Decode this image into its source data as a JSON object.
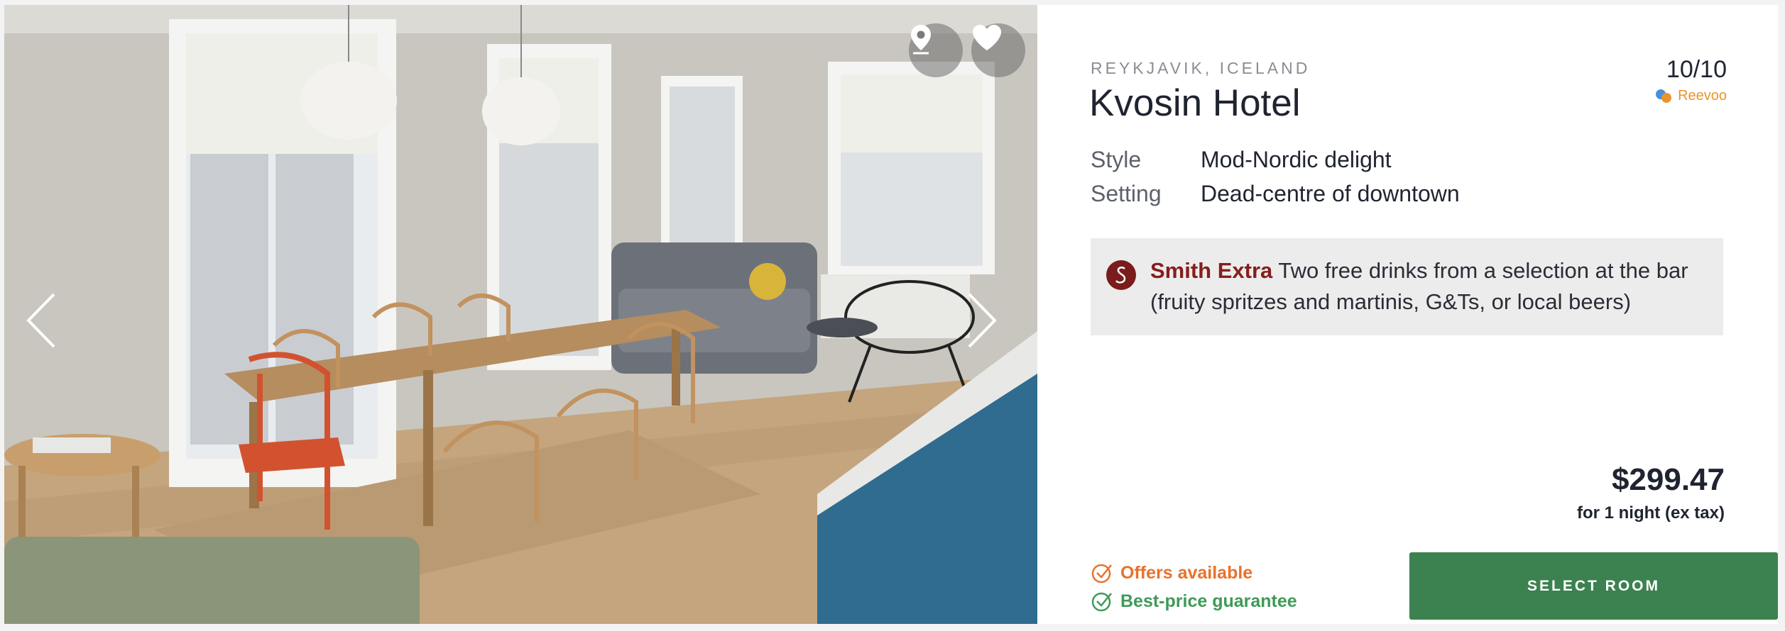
{
  "hotel": {
    "location": "REYKJAVIK, ICELAND",
    "name": "Kvosin Hotel",
    "score": "10/10",
    "review_source": "Reevoo",
    "attributes": [
      {
        "key": "Style",
        "value": "Mod-Nordic delight"
      },
      {
        "key": "Setting",
        "value": "Dead-centre of downtown"
      }
    ]
  },
  "extra": {
    "brand": "Smith Extra",
    "text": "Two free drinks from a selection at the bar (fruity spritzes and martinis, G&Ts, or local beers)"
  },
  "pricing": {
    "price": "$299.47",
    "note": "for 1 night (ex tax)"
  },
  "badges": {
    "offers": "Offers available",
    "guarantee": "Best-price guarantee"
  },
  "actions": {
    "select": "SELECT ROOM"
  },
  "icons": {
    "map": "map-pin-icon",
    "favourite": "heart-icon",
    "prev": "chevron-left-icon",
    "next": "chevron-right-icon",
    "extra": "smith-logo-icon",
    "check": "check-circle-icon"
  },
  "colors": {
    "brand_red": "#861d1d",
    "offers_orange": "#e8722c",
    "guarantee_green": "#3f9a57",
    "button_green": "#3c8150",
    "reevoo_orange": "#e8952e"
  }
}
